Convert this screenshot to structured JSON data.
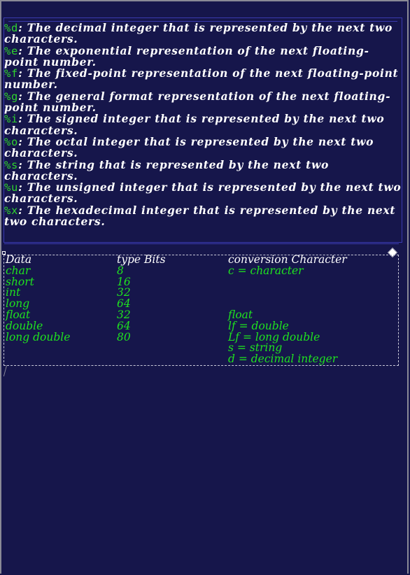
{
  "definitions": [
    {
      "spec": "%d",
      "text": ": The decimal integer that is represented by the next two characters."
    },
    {
      "spec": "%e",
      "text": ": The exponential representation of the next floating-point number."
    },
    {
      "spec": "%f",
      "text": ": The fixed-point representation of the next floating-point number."
    },
    {
      "spec": "%g",
      "text": ": The general format representation of the next floating-point number."
    },
    {
      "spec": "%i",
      "text": ": The signed integer that is represented by the next two characters."
    },
    {
      "spec": "%o",
      "text": ": The octal integer that is represented by the next two characters."
    },
    {
      "spec": "%s",
      "text": ": The string that is represented by the next two characters."
    },
    {
      "spec": "%u",
      "text": ": The unsigned integer that is represented by the next two characters."
    },
    {
      "spec": "%x",
      "text": ": The hexadecimal integer that is represented by the next two characters."
    }
  ],
  "table": {
    "headers": [
      "Data",
      "type Bits",
      "conversion Character"
    ],
    "data_col": [
      "char",
      "short",
      "int",
      "long",
      "float",
      "double",
      "long double"
    ],
    "bits_col": [
      "8",
      "16",
      "32",
      "64",
      "32",
      "64",
      "80"
    ],
    "conv_col": [
      "c = character",
      "",
      "",
      "",
      "float",
      "lf = double",
      "Lf = long double",
      "s = string",
      "d = decimal integer"
    ]
  },
  "colors": {
    "background": "#16164b",
    "text": "#ffffff",
    "accent_green": "#1fe21f",
    "panel_border": "#3a3ab0"
  }
}
